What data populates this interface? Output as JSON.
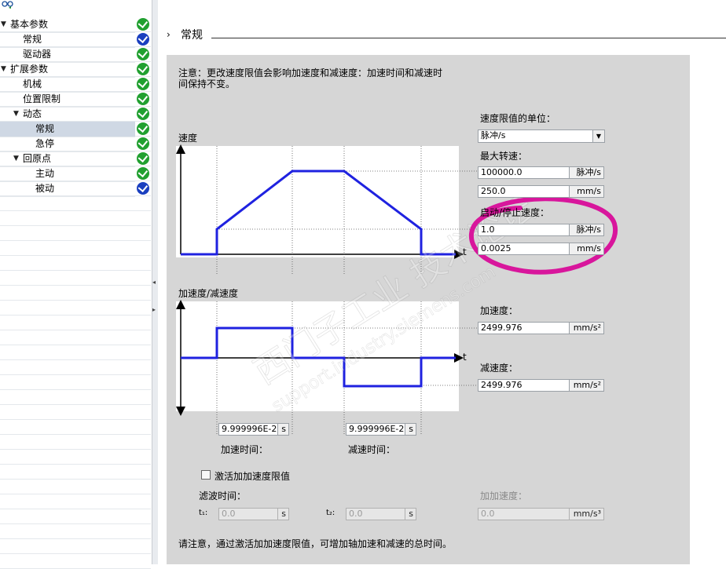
{
  "tree": {
    "items": [
      {
        "label": "基本参数",
        "level": 0,
        "expanded": true,
        "status": "ok"
      },
      {
        "label": "常规",
        "level": 1,
        "status": "info"
      },
      {
        "label": "驱动器",
        "level": 1,
        "status": "ok"
      },
      {
        "label": "扩展参数",
        "level": 0,
        "expanded": true,
        "status": "ok"
      },
      {
        "label": "机械",
        "level": 1,
        "status": "ok"
      },
      {
        "label": "位置限制",
        "level": 1,
        "status": "ok"
      },
      {
        "label": "动态",
        "level": 1,
        "expanded": true,
        "status": "ok"
      },
      {
        "label": "常规",
        "level": 2,
        "selected": true,
        "status": "ok"
      },
      {
        "label": "急停",
        "level": 2,
        "status": "ok"
      },
      {
        "label": "回原点",
        "level": 1,
        "expanded": true,
        "status": "ok"
      },
      {
        "label": "主动",
        "level": 2,
        "status": "ok"
      },
      {
        "label": "被动",
        "level": 2,
        "status": "info"
      }
    ]
  },
  "section": {
    "title": "常规"
  },
  "note": {
    "line1": "注意：更改速度限值会影响加速度和减速度：加速时间和减速时",
    "line2": "间保持不变。"
  },
  "velocity_chart": {
    "ylabel": "速度",
    "xlabel": "t"
  },
  "accel_chart": {
    "ylabel": "加速度/减速度",
    "xlabel": "t"
  },
  "speed_unit": {
    "label": "速度限值的单位：",
    "value": "脉冲/s"
  },
  "max_speed": {
    "label": "最大转速：",
    "value_pulse": "100000.0",
    "unit_pulse": "脉冲/s",
    "value_mm": "250.0",
    "unit_mm": "mm/s"
  },
  "start_stop_speed": {
    "label": "启动/停止速度：",
    "value_pulse": "1.0",
    "unit_pulse": "脉冲/s",
    "value_mm": "0.0025",
    "unit_mm": "mm/s"
  },
  "acceleration": {
    "label": "加速度：",
    "value": "2499.976",
    "unit": "mm/s²"
  },
  "deceleration": {
    "label": "减速度：",
    "value": "2499.976",
    "unit": "mm/s²"
  },
  "accel_time": {
    "label": "加速时间：",
    "value": "9.999996E-2",
    "unit": "s"
  },
  "decel_time": {
    "label": "减速时间：",
    "value": "9.999996E-2",
    "unit": "s"
  },
  "jerk_limit": {
    "checkbox_label": "激活加加速度限值",
    "checked": false
  },
  "filter_time": {
    "label": "滤波时间：",
    "t1_label": "t₁:",
    "t1_value": "0.0",
    "t1_unit": "s",
    "t2_label": "t₂:",
    "t2_value": "0.0",
    "t2_unit": "s"
  },
  "jerk": {
    "label": "加加速度：",
    "value": "0.0",
    "unit": "mm/s³"
  },
  "bottom_note": "请注意，通过激活加加速度限值，可增加轴加速和减速的总时间。",
  "watermark": "西门子工业 技术论坛 support.industry.siemens.com",
  "colors": {
    "curve": "#1f22e0",
    "annotation": "#d8169c",
    "panel": "#d6d6d6",
    "ok": "#21a030",
    "info": "#1a3fbf"
  }
}
